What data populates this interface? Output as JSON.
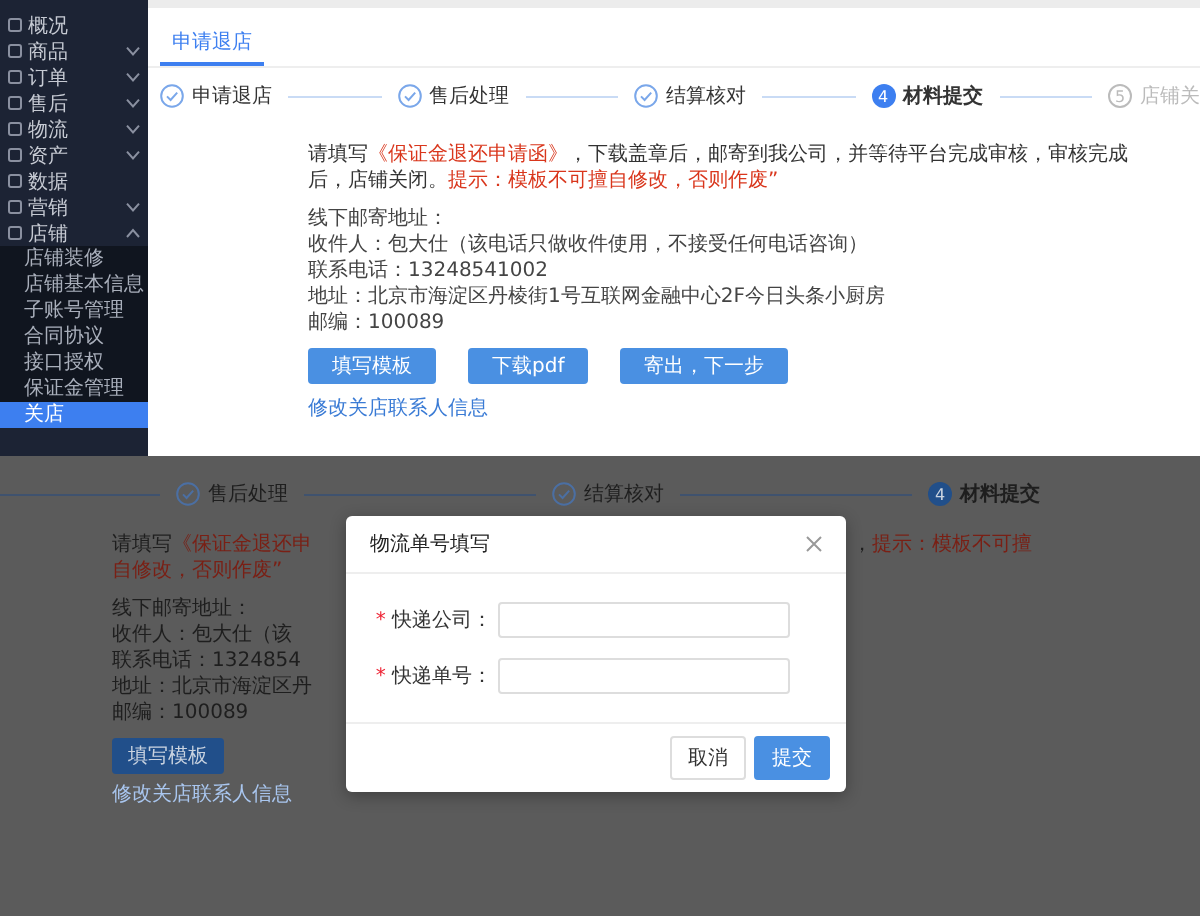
{
  "top": {
    "sidebar": {
      "items": [
        {
          "label": "概况"
        },
        {
          "label": "商品",
          "expanded": false
        },
        {
          "label": "订单",
          "expanded": false
        },
        {
          "label": "售后",
          "expanded": false
        },
        {
          "label": "物流",
          "expanded": false
        },
        {
          "label": "资产",
          "expanded": false
        },
        {
          "label": "数据"
        },
        {
          "label": "营销",
          "expanded": false
        },
        {
          "label": "店铺",
          "expanded": true,
          "children": [
            {
              "label": "店铺装修",
              "selected": false
            },
            {
              "label": "店铺基本信息",
              "selected": false
            },
            {
              "label": "子账号管理",
              "selected": false
            },
            {
              "label": "合同协议",
              "selected": false
            },
            {
              "label": "接口授权",
              "selected": false
            },
            {
              "label": "保证金管理",
              "selected": false
            },
            {
              "label": "关店",
              "selected": true
            }
          ]
        }
      ]
    },
    "tab": {
      "label": "申请退店",
      "selected": true
    },
    "steps": [
      {
        "label": "申请退店",
        "completed": true,
        "current": false
      },
      {
        "label": "售后处理",
        "completed": true,
        "current": false
      },
      {
        "label": "结算核对",
        "completed": true,
        "current": false
      },
      {
        "label": "材料提交",
        "completed": false,
        "current": true,
        "number": "4"
      },
      {
        "label": "店铺关",
        "completed": false,
        "current": false,
        "number": "5"
      }
    ],
    "notice": [
      {
        "text": "请填写",
        "kind": "plain"
      },
      {
        "text": "《保证金退还申请函》",
        "kind": "highlight"
      },
      {
        "text": "，下载盖章后，邮寄到我公司，并等待平台完成审核，审核完成后，店铺关闭。",
        "kind": "plain"
      },
      {
        "text": "提示：模板不可擅自修改，否则作废”",
        "kind": "highlight"
      }
    ],
    "address": [
      "线下邮寄地址：",
      "收件人：包大仕（该电话只做收件使用，不接受任何电话咨询）",
      "联系电话：13248541002",
      "地址：北京市海淀区丹棱街1号互联网金融中心2F今日头条小厨房",
      "邮编：100089"
    ],
    "buttons": [
      {
        "label": "填写模板"
      },
      {
        "label": "下载pdf"
      },
      {
        "label": "寄出，下一步"
      }
    ],
    "link": "修改关店联系人信息"
  },
  "bottom": {
    "steps": [
      {
        "label": "售后处理",
        "completed": true,
        "current": false
      },
      {
        "label": "结算核对",
        "completed": true,
        "current": false
      },
      {
        "label": "材料提交",
        "completed": false,
        "current": true,
        "number": "4"
      }
    ],
    "notice_left": [
      {
        "text": "请填写",
        "kind": "plain"
      },
      {
        "text": "《保证金退还申",
        "kind": "highlight"
      }
    ],
    "notice_right": [
      {
        "text": "，",
        "kind": "plain"
      },
      {
        "text": "提示：模板不可擅",
        "kind": "highlight"
      }
    ],
    "notice_line_2": [
      {
        "text": "自修改，否则作废”",
        "kind": "highlight"
      }
    ],
    "address": [
      "线下邮寄地址：",
      "收件人：包大仕（该",
      "联系电话：1324854",
      "地址：北京市海淀区丹",
      "邮编：100089"
    ],
    "button": "填写模板",
    "link": "修改关店联系人信息",
    "dialog": {
      "title": "物流单号填写",
      "fields": [
        {
          "label": "快递公司：",
          "required_mark": "*"
        },
        {
          "label": "快递单号：",
          "required_mark": "*"
        }
      ],
      "buttons": [
        {
          "label": "取消",
          "kind": "secondary"
        },
        {
          "label": "提交",
          "kind": "primary"
        }
      ]
    }
  }
}
